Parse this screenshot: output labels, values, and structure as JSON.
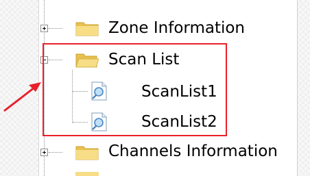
{
  "tree": {
    "items": [
      {
        "label": "Zone Information",
        "expander": "plus",
        "icon": "folder-icon"
      },
      {
        "label": "Scan List",
        "expander": "minus",
        "icon": "folder-icon"
      },
      {
        "label": "ScanList1",
        "icon": "document-search-icon"
      },
      {
        "label": "ScanList2",
        "icon": "document-search-icon"
      },
      {
        "label": "Channels Information",
        "expander": "plus",
        "icon": "folder-icon"
      }
    ]
  },
  "colors": {
    "highlight": "#e8202a",
    "arrow": "#e8202a",
    "folder": "#f5d97a",
    "folder_dark": "#e8c04f"
  }
}
